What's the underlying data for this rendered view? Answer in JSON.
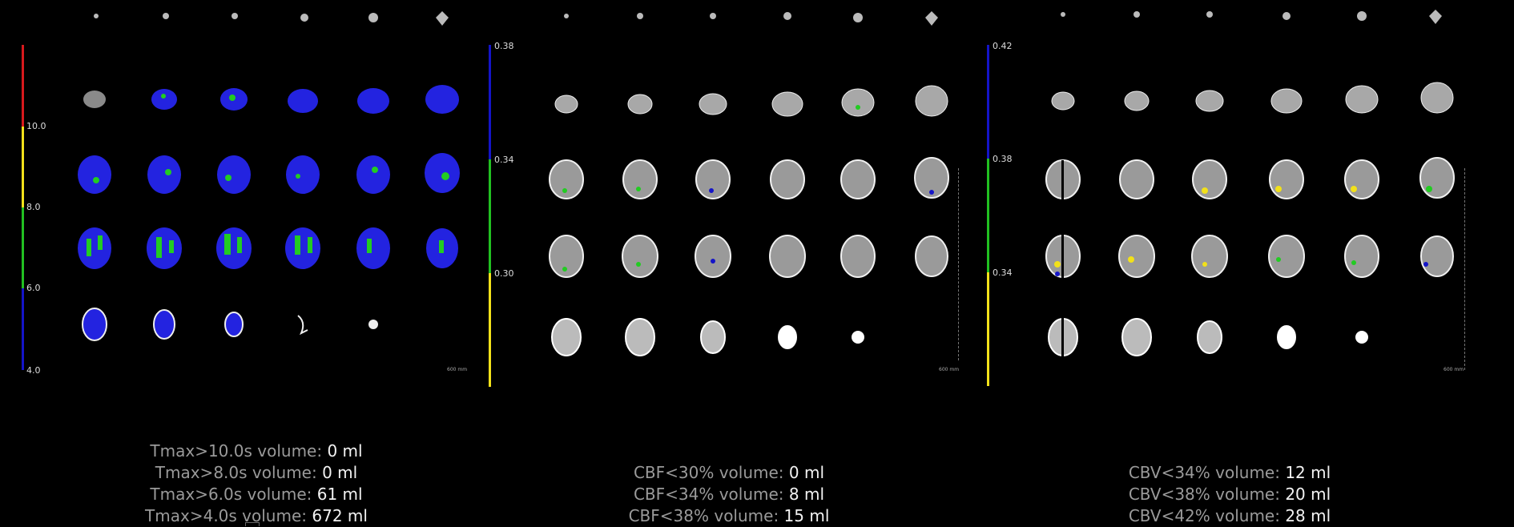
{
  "panels": [
    {
      "name": "tmax",
      "scale": {
        "ticks": [
          "10.0",
          "8.0",
          "6.0",
          "4.0"
        ],
        "colors": {
          "top": "#d7191c",
          "upper": "#f2e11a",
          "mid": "#21c021",
          "low": "#1414c8"
        }
      },
      "unit_label": "600 mm",
      "stats": [
        {
          "label": "Tmax>10.0s volume:",
          "value": "0 ml"
        },
        {
          "label": "Tmax>8.0s volume:",
          "value": "0 ml"
        },
        {
          "label": "Tmax>6.0s volume:",
          "value": "61 ml"
        },
        {
          "label": "Tmax>4.0s volume:",
          "value": "672 ml"
        }
      ]
    },
    {
      "name": "cbf",
      "scale": {
        "ticks": [
          "0.38",
          "0.34",
          "0.30"
        ],
        "colors": {
          "top": "#1414c8",
          "mid": "#21c021",
          "low": "#f2e11a"
        }
      },
      "unit_label": "600 mm",
      "stats": [
        {
          "label": "CBF<30% volume:",
          "value": "0 ml"
        },
        {
          "label": "CBF<34% volume:",
          "value": "8 ml"
        },
        {
          "label": "CBF<38% volume:",
          "value": "15 ml"
        }
      ]
    },
    {
      "name": "cbv",
      "scale": {
        "ticks": [
          "0.42",
          "0.38",
          "0.34"
        ],
        "colors": {
          "top": "#1414c8",
          "mid": "#21c021",
          "low": "#f2e11a"
        }
      },
      "unit_label": "600 mm",
      "stats": [
        {
          "label": "CBV<34% volume:",
          "value": "12 ml"
        },
        {
          "label": "CBV<38% volume:",
          "value": "20 ml"
        },
        {
          "label": "CBV<42% volume:",
          "value": "28 ml"
        }
      ]
    }
  ]
}
